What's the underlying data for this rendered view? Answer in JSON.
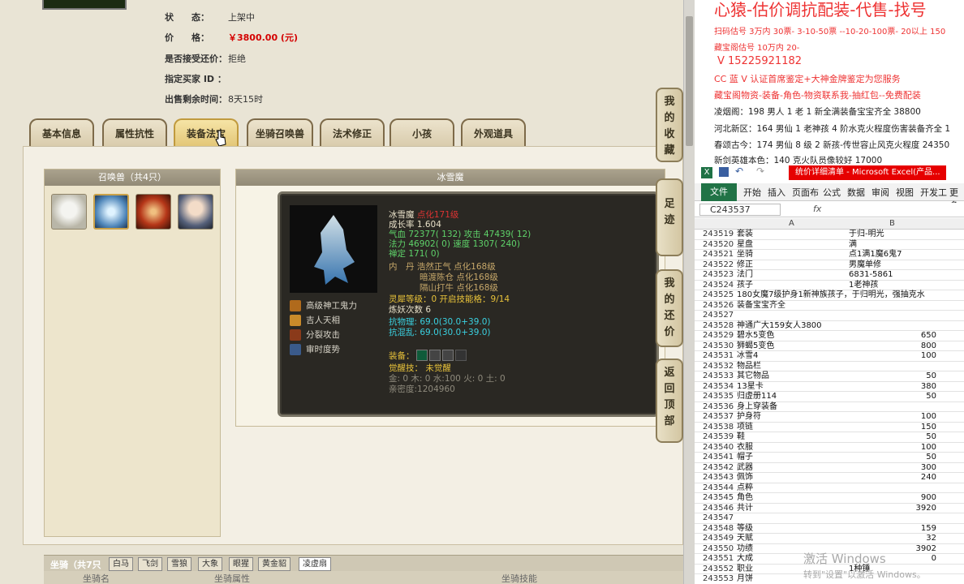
{
  "item_info": {
    "status_label": "状　　态：",
    "status_value": "上架中",
    "price_label": "价　　格：",
    "price_value": "￥3800.00 (元)",
    "counter_label": "是否接受还价：",
    "counter_value": "拒绝",
    "buyer_label": "指定买家 ID ：",
    "buyer_value": "",
    "time_label": "出售剩余时间：",
    "time_value": "8天15时"
  },
  "tabs": [
    "基本信息",
    "属性抗性",
    "装备法宝",
    "坐骑召唤兽",
    "法术修正",
    "小孩",
    "外观道具"
  ],
  "active_tab": "装备法宝",
  "summons": {
    "title": "召唤兽（共4只）",
    "selected_title": "冰雪魔"
  },
  "pet_popup": {
    "name": "冰雪魔",
    "extra": "点化171级",
    "growth": "成长率 1.604",
    "hp": "气血 72377( 132) 攻击 47439( 12)",
    "mp": "法力 46902( 0) 速度 1307( 240)",
    "focus": "禅定 171( 0)",
    "inner": "内　丹 浩然正气 点化168级",
    "inner2": "暗渡陈仓 点化168级",
    "inner3": "隔山打牛 点化168级",
    "spirit": "灵犀等级：0 开启技能格：9/14",
    "refine": "炼妖次数 6",
    "res1": "抗物理: 69.0(30.0+39.0)",
    "res2": "抗混乱: 69.0(30.0+39.0)",
    "equip_label": "装备：",
    "awaken": "觉醒技： 未觉醒",
    "elements": "金: 0 木: 0 水:100 火: 0 土: 0",
    "intimacy": "亲密度:1204960",
    "skills": [
      "高级神工鬼力",
      "吉人天相",
      "分裂攻击",
      "审时度势"
    ]
  },
  "side_buttons": [
    "我的收藏",
    "足迹",
    "我的还价",
    "返回顶部"
  ],
  "mount_bar": {
    "label": "坐骑（共7只",
    "tabs": [
      "白马",
      "飞剑",
      "雪狼",
      "大象",
      "眼猩",
      "黄金貂",
      "凌虚扇"
    ],
    "cols": [
      "坐骑名",
      "坐骑属性",
      "坐骑技能"
    ]
  },
  "ad": {
    "title": "心猿-估价调抗配装-代售-找号",
    "lines": [
      "扫码估号 3万内 30票- 3-10-50票 --10-20-100票- 20以上 150",
      "藏宝阁估号 10万内 20-  ",
      "V 15225921182",
      "CC 蓝 V 认证首席鉴定+大神金牌鉴定为您服务",
      "藏宝阁物资-装备-角色-物资联系我-抽红包--免费配装",
      "凌烟阁：198 男人 1 老 1 新全满装备宝宝齐全 38800",
      "河北新区：164 男仙 1 老神孩 4 阶水克火程度伤害装备齐全 1",
      "春颂古今：174 男仙 8 级 2 新孩-传世容止风克火程度 24350",
      "新剑英雄本色：140 克火队员像较好 17000"
    ]
  },
  "excel": {
    "title": "统价详细清单 - Microsoft Excel(产品...",
    "ribbon": [
      "文件",
      "开始",
      "插入",
      "页面布",
      "公式",
      "数据",
      "审阅",
      "视图",
      "开发工",
      "更多"
    ],
    "namebox": "C243537",
    "fx": "fx",
    "col_a": "A",
    "col_b": "B",
    "rows": [
      [
        "243519",
        "套装",
        "于归-明光",
        false
      ],
      [
        "243520",
        "星盘",
        "满",
        false
      ],
      [
        "243521",
        "坐骑",
        "点1满1魔6鬼7",
        false
      ],
      [
        "243522",
        "修正",
        "男魔单修",
        false
      ],
      [
        "243523",
        "法门",
        "6831-5861",
        false
      ],
      [
        "243524",
        "孩子",
        "1老神孩",
        false
      ],
      [
        "243525",
        "180女魔7级护身1新神族孩子，于归明光，强抽克水",
        "",
        false
      ],
      [
        "243526",
        "装备宝宝齐全",
        "",
        false
      ],
      [
        "243527",
        "",
        "",
        false
      ],
      [
        "243528",
        "神通广大159女人3800",
        "",
        false
      ],
      [
        "243529",
        "碧水5变色",
        "650",
        true
      ],
      [
        "243530",
        "狮蝎5变色",
        "800",
        true
      ],
      [
        "243531",
        "冰雪4",
        "100",
        true
      ],
      [
        "243532",
        "物品栏",
        "",
        false
      ],
      [
        "243533",
        "其它物品",
        "50",
        true
      ],
      [
        "243534",
        "13星卡",
        "380",
        true
      ],
      [
        "243535",
        "归虚册114",
        "50",
        true
      ],
      [
        "243536",
        "身上穿装备",
        "",
        false
      ],
      [
        "243537",
        "护身符",
        "100",
        true
      ],
      [
        "243538",
        "项链",
        "150",
        true
      ],
      [
        "243539",
        "鞋",
        "50",
        true
      ],
      [
        "243540",
        "衣服",
        "100",
        true
      ],
      [
        "243541",
        "帽子",
        "50",
        true
      ],
      [
        "243542",
        "武器",
        "300",
        true
      ],
      [
        "243543",
        "佩饰",
        "240",
        true
      ],
      [
        "243544",
        "点粹",
        "",
        false
      ],
      [
        "243545",
        "角色",
        "900",
        true
      ],
      [
        "243546",
        "共计",
        "3920",
        true
      ],
      [
        "243547",
        "",
        "",
        false
      ],
      [
        "243548",
        "等级",
        "159",
        true
      ],
      [
        "243549",
        "天赋",
        "32",
        true
      ],
      [
        "243550",
        "功绩",
        "3902",
        true
      ],
      [
        "243551",
        "大成",
        "0",
        true
      ],
      [
        "243552",
        "职业",
        "1种锤",
        false
      ],
      [
        "243553",
        "月饼",
        "",
        false
      ]
    ]
  },
  "watermark": {
    "line1": "激活 Windows",
    "line2": "转到\"设置\"以激活 Windows。"
  }
}
